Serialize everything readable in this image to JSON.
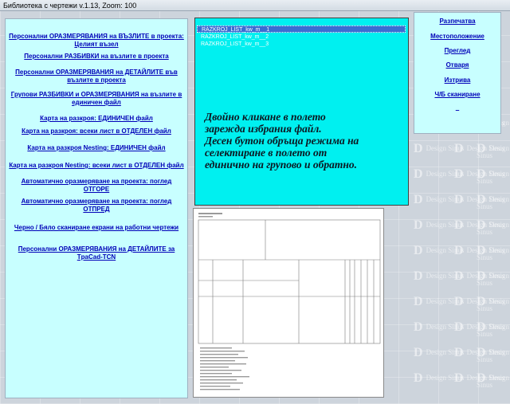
{
  "window": {
    "title": "Библиотека с чертежи v.1.13, Zoom:  100"
  },
  "watermark": {
    "letter": "D",
    "line1": "Design",
    "line2": "Sinus"
  },
  "left_menu": {
    "items": [
      {
        "line1": "Персонални ОРАЗМЕРЯВАНИЯ на ВЪЗЛИТЕ в проекта:",
        "line2": "Целият възел"
      },
      {
        "line1": "Персонални РАЗБИВКИ на възлите в проекта",
        "line2": ""
      },
      {
        "line1": "Персонални ОРАЗМЕРЯВАНИЯ на ДЕТАЙЛИТЕ във",
        "line2": "възлите в проекта"
      },
      {
        "line1": "Групови РАЗБИВКИ и ОРАЗМЕРЯВАНИЯ на възлите в",
        "line2": "единичен файл"
      },
      {
        "line1": "Карта на разкроя: ЕДИНИЧЕН файл",
        "line2": ""
      },
      {
        "line1": "Карта на разкроя: всеки лист в ОТДЕЛЕН файл",
        "line2": ""
      },
      {
        "line1": "Карта на разкроя Nesting: ЕДИНИЧЕН файл",
        "line2": ""
      },
      {
        "line1": "Карта на разкроя Nesting: всеки лист в ОТДЕЛЕН файл",
        "line2": ""
      },
      {
        "line1": "Автоматично оразмеряване на проекта: поглед",
        "line2": "ОТГОРЕ"
      },
      {
        "line1": "Автоматично оразмеряване на проекта: поглед",
        "line2": "ОТПРЕД"
      },
      {
        "line1": "Черно / Бяло сканиране екрани на работни чертежи",
        "line2": ""
      },
      {
        "line1": "Персонални ОРАЗМЕРЯВАНИЯ на ДЕТАЙЛИТЕ за",
        "line2": "TpaCad-TCN"
      }
    ]
  },
  "file_list": {
    "files": [
      "RAZKROJ_LIST_kw_m__1",
      "RAZKROJ_LIST_kw_m__2",
      "RAZKROJ_LIST_kw_m__3"
    ],
    "selected_index": 0,
    "hint_lines": [
      "Двойно кликане в полето",
      "зарежда избрания файл.",
      "Десен бутон обръща режима на",
      "селектиране в полето от",
      "единично на групово и обратно."
    ]
  },
  "right_menu": {
    "items": [
      "Разпечатва",
      "Местоположение",
      "Преглед",
      "Отваря",
      "Изтрива",
      "Ч/Б сканиране"
    ],
    "dash": "–"
  },
  "colors": {
    "panel_bg": "#c8ffff",
    "list_bg": "#00f0f0",
    "link": "#0000b8",
    "selected": "#3a6ed1"
  }
}
